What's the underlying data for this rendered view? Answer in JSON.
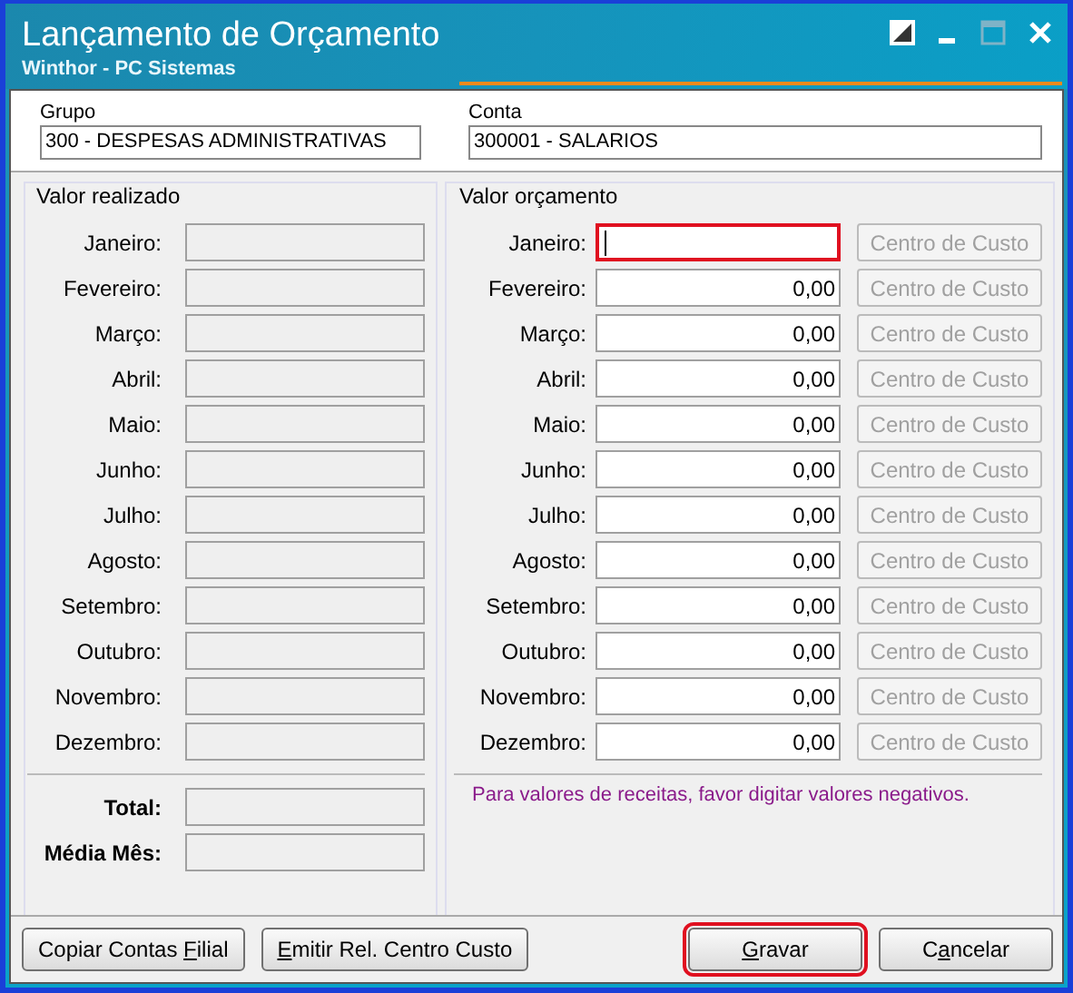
{
  "window": {
    "title": "Lançamento de Orçamento",
    "subtitle": "Winthor - PC Sistemas",
    "maximize_disabled": true
  },
  "header_fields": [
    {
      "label": "Grupo",
      "value": "300 - DESPESAS ADMINISTRATIVAS"
    },
    {
      "label": "Conta",
      "value": "300001 - SALARIOS"
    }
  ],
  "realizado": {
    "title": "Valor realizado",
    "months": [
      "Janeiro:",
      "Fevereiro:",
      "Março:",
      "Abril:",
      "Maio:",
      "Junho:",
      "Julho:",
      "Agosto:",
      "Setembro:",
      "Outubro:",
      "Novembro:",
      "Dezembro:"
    ],
    "totals": [
      "Total:",
      "Média Mês:"
    ]
  },
  "orcamento": {
    "title": "Valor orçamento",
    "rows": [
      {
        "label": "Janeiro:",
        "value": "",
        "focused": true,
        "highlighted": true,
        "button": "Centro de Custo",
        "button_disabled": true
      },
      {
        "label": "Fevereiro:",
        "value": "0,00",
        "focused": false,
        "highlighted": false,
        "button": "Centro de Custo",
        "button_disabled": true
      },
      {
        "label": "Março:",
        "value": "0,00",
        "focused": false,
        "highlighted": false,
        "button": "Centro de Custo",
        "button_disabled": true
      },
      {
        "label": "Abril:",
        "value": "0,00",
        "focused": false,
        "highlighted": false,
        "button": "Centro de Custo",
        "button_disabled": true
      },
      {
        "label": "Maio:",
        "value": "0,00",
        "focused": false,
        "highlighted": false,
        "button": "Centro de Custo",
        "button_disabled": true
      },
      {
        "label": "Junho:",
        "value": "0,00",
        "focused": false,
        "highlighted": false,
        "button": "Centro de Custo",
        "button_disabled": true
      },
      {
        "label": "Julho:",
        "value": "0,00",
        "focused": false,
        "highlighted": false,
        "button": "Centro de Custo",
        "button_disabled": true
      },
      {
        "label": "Agosto:",
        "value": "0,00",
        "focused": false,
        "highlighted": false,
        "button": "Centro de Custo",
        "button_disabled": true
      },
      {
        "label": "Setembro:",
        "value": "0,00",
        "focused": false,
        "highlighted": false,
        "button": "Centro de Custo",
        "button_disabled": true
      },
      {
        "label": "Outubro:",
        "value": "0,00",
        "focused": false,
        "highlighted": false,
        "button": "Centro de Custo",
        "button_disabled": true
      },
      {
        "label": "Novembro:",
        "value": "0,00",
        "focused": false,
        "highlighted": false,
        "button": "Centro de Custo",
        "button_disabled": true
      },
      {
        "label": "Dezembro:",
        "value": "0,00",
        "focused": false,
        "highlighted": false,
        "button": "Centro de Custo",
        "button_disabled": true
      }
    ],
    "note": "Para valores de receitas, favor digitar valores negativos."
  },
  "left_buttons": [
    {
      "before": "Copiar Contas ",
      "key": "F",
      "after": "ilial",
      "highlighted": false
    },
    {
      "key": "E",
      "after": "mitir Rel. Centro Custo",
      "highlighted": false
    }
  ],
  "right_buttons": [
    {
      "key": "G",
      "after": "ravar",
      "highlighted": true
    },
    {
      "before": "C",
      "key": "a",
      "after": "ncelar",
      "highlighted": false
    }
  ]
}
